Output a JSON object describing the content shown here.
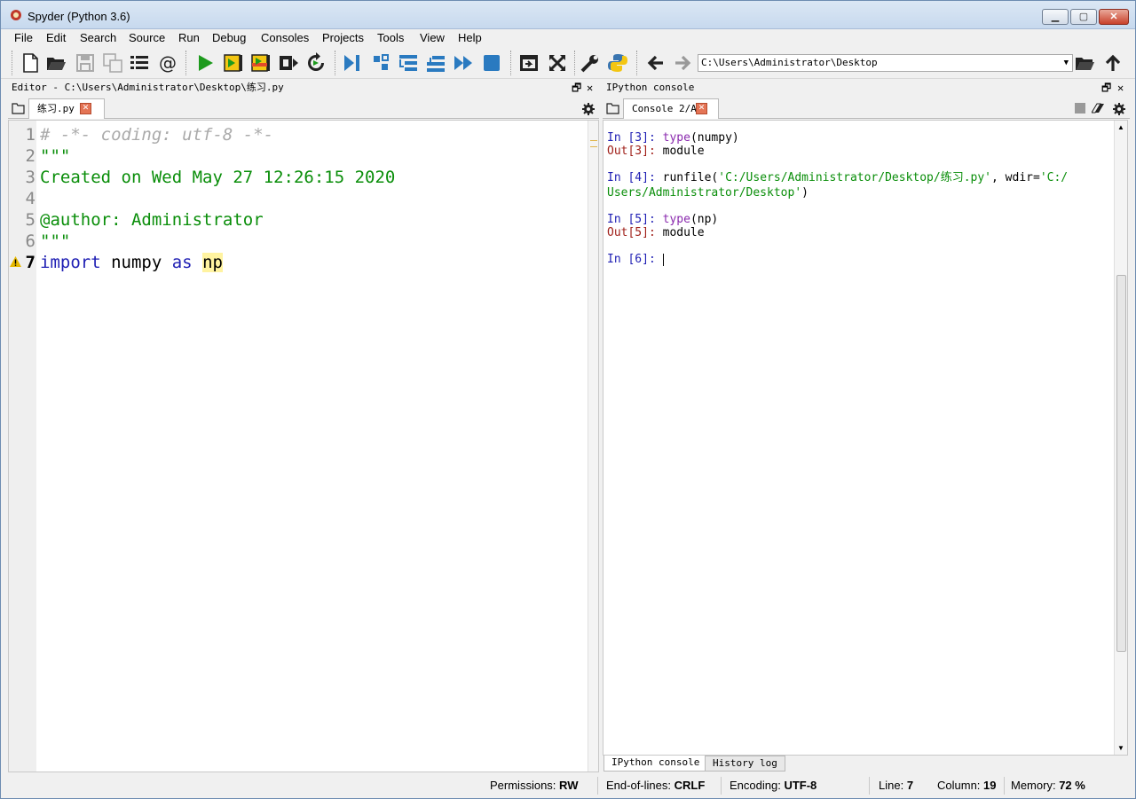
{
  "window": {
    "title": "Spyder (Python 3.6)"
  },
  "menu": [
    "File",
    "Edit",
    "Search",
    "Source",
    "Run",
    "Debug",
    "Consoles",
    "Projects",
    "Tools",
    "View",
    "Help"
  ],
  "toolbar": {
    "path": "C:\\Users\\Administrator\\Desktop",
    "icons": [
      "new-file-icon",
      "open-file-icon",
      "save-icon",
      "save-all-icon",
      "outline-icon",
      "at-icon",
      "run-icon",
      "run-cell-icon",
      "run-cell-advance-icon",
      "run-selection-icon",
      "rerun-icon",
      "debug-icon",
      "step-icon",
      "step-into-icon",
      "step-return-icon",
      "continue-icon",
      "stop-icon",
      "maximize-pane-icon",
      "fullscreen-icon",
      "preferences-icon",
      "python-path-icon",
      "back-icon",
      "forward-icon",
      "browse-folder-icon",
      "parent-dir-icon"
    ]
  },
  "editor": {
    "title": "Editor - C:\\Users\\Administrator\\Desktop\\练习.py",
    "tab": "练习.py",
    "lines": [
      {
        "num": "1",
        "text": "# -*- coding: utf-8 -*-"
      },
      {
        "num": "2",
        "text": "\"\"\""
      },
      {
        "num": "3",
        "text": "Created on Wed May 27 12:26:15 2020"
      },
      {
        "num": "4",
        "text": ""
      },
      {
        "num": "5",
        "text": "@author: Administrator"
      },
      {
        "num": "6",
        "text": "\"\"\""
      },
      {
        "num": "7",
        "kw1": "import",
        "mod": " numpy ",
        "kw2": "as",
        "alias": "np"
      }
    ]
  },
  "console": {
    "title": "IPython console",
    "tab": "Console 2/A",
    "blocks": [
      {
        "in": "In [3]: ",
        "fn": "type",
        "rest": "(numpy)"
      },
      {
        "out": "Out[3]: ",
        "value": "module"
      },
      {
        "in": "In [4]: ",
        "call": "runfile(",
        "s1": "'C:/Users/Administrator/Desktop/练习.py'",
        "mid": ", wdir=",
        "s2a": "'C:/",
        "s2b": "Users/Administrator/Desktop'",
        "end": ")"
      },
      {
        "in": "In [5]: ",
        "fn": "type",
        "rest": "(np)"
      },
      {
        "out": "Out[5]: ",
        "value": "module"
      },
      {
        "in": "In [6]: "
      }
    ],
    "bottom_tabs": [
      "IPython console",
      "History log"
    ]
  },
  "status": {
    "permissions_label": "Permissions:",
    "permissions": "RW",
    "eol_label": "End-of-lines:",
    "eol": "CRLF",
    "encoding_label": "Encoding:",
    "encoding": "UTF-8",
    "line_label": "Line:",
    "line": "7",
    "column_label": "Column:",
    "column": "19",
    "memory_label": "Memory:",
    "memory": "72 %"
  },
  "colors": {
    "string_green": "#0a8e0a",
    "keyword_blue": "#2020b4",
    "comment_gray": "#aaaaaa",
    "current_line": "#f8e8f7"
  }
}
